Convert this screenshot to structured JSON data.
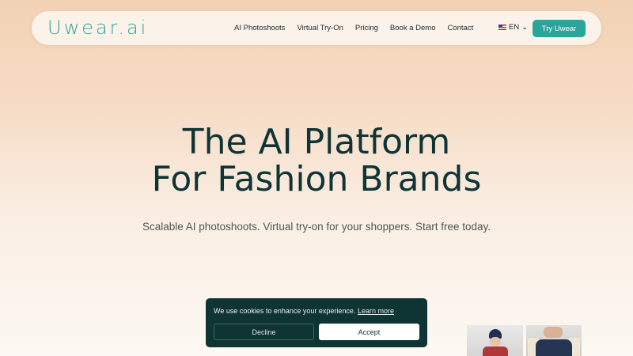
{
  "nav": {
    "logo": "Uwear.ai",
    "menu": [
      "AI Photoshoots",
      "Virtual Try-On",
      "Pricing",
      "Book a Demo",
      "Contact"
    ],
    "language": "EN",
    "cta": "Try Uwear"
  },
  "hero": {
    "title_line1": "The AI Platform",
    "title_line2": "For Fashion Brands",
    "subtitle": "Scalable AI photoshoots. Virtual try-on for your shoppers. Start free today."
  },
  "cookie_banner": {
    "text": "We use cookies to enhance your experience.",
    "link": "Learn more",
    "decline": "Decline",
    "accept": "Accept"
  },
  "colors": {
    "brand": "#2aa59a",
    "dark": "#0f3434"
  }
}
